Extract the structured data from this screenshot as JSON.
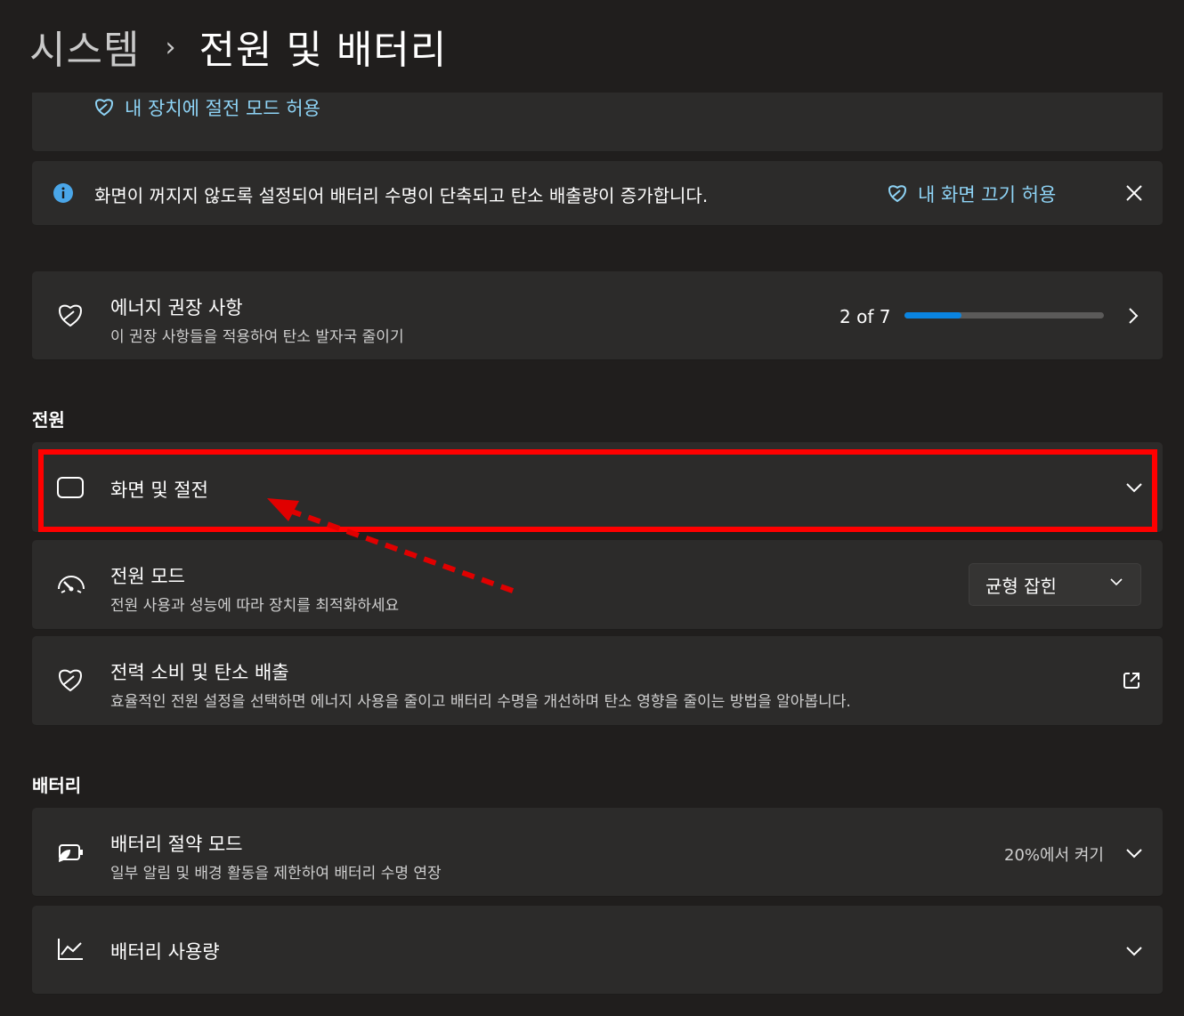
{
  "breadcrumb": {
    "parent": "시스템",
    "separator": "›",
    "current": "전원 및 배터리"
  },
  "sleep_notice": {
    "link": "내 장치에 절전 모드 허용",
    "icon": "leaf-icon"
  },
  "screen_notice": {
    "message": "화면이 꺼지지 않도록 설정되어 배터리 수명이 단축되고 탄소 배출량이 증가합니다.",
    "link": "내 화면 끄기 허용",
    "icon": "info-icon"
  },
  "energy_recommendations": {
    "title": "에너지 권장 사항",
    "subtitle": "이 권장 사항들을 적용하여 탄소 발자국 줄이기",
    "progress_text": "2 of 7",
    "progress_fraction": 0.2857
  },
  "sections": {
    "power": "전원",
    "battery": "배터리"
  },
  "screen_sleep": {
    "title": "화면 및 절전"
  },
  "power_mode": {
    "title": "전원 모드",
    "subtitle": "전원 사용과 성능에 따라 장치를 최적화하세요",
    "selected": "균형 잡힌"
  },
  "power_consumption": {
    "title": "전력 소비 및 탄소 배출",
    "subtitle": "효율적인 전원 설정을 선택하면 에너지 사용을 줄이고 배터리 수명을 개선하며 탄소 영향을 줄이는 방법을 알아봅니다."
  },
  "battery_saver": {
    "title": "배터리 절약 모드",
    "subtitle": "일부 알림 및 배경 활동을 제한하여 배터리 수명 연장",
    "status": "20%에서 켜기"
  },
  "battery_usage": {
    "title": "배터리 사용량"
  },
  "colors": {
    "accent": "#0a84e0",
    "link": "#8ed3f5",
    "highlight": "#ff0000",
    "card": "#2c2b2a",
    "background": "#201e1d"
  }
}
